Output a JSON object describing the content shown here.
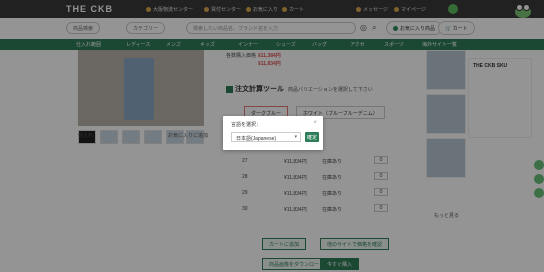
{
  "site": {
    "logo": "THE CKB"
  },
  "topbar": {
    "items": [
      "大阪物流センター",
      "買付センター",
      "お気に入り",
      "カート",
      "メッセージ",
      "マイページ"
    ]
  },
  "search": {
    "scope": "商品検索",
    "category": "カテゴリー",
    "placeholder": "検索したい商品名、ブランド名を入力",
    "fav_button": "お気に入り商品",
    "cart_button": "カート"
  },
  "nav": {
    "items": [
      "仕入れ範囲",
      "レディース",
      "メンズ",
      "キッズ",
      "インナー",
      "シューズ",
      "バッグ",
      "アクセ",
      "スポーツ",
      "海外サイト一覧"
    ]
  },
  "product": {
    "price_label": "各数購入価格",
    "price1": "¥11,384円",
    "price2": "¥11,834円",
    "tool_title": "注文計算ツール",
    "variation_note": "商品バリエーションを選択して下さい",
    "color_tab1": "ダークブルー",
    "color_tab2": "ホワイト（ブルーブルーデニム）",
    "thumb_label1": "仕入れ",
    "thumb_label2": "お気に入りに追加",
    "rows": [
      {
        "size": "27",
        "price": "¥11,834円",
        "stock": "在庫あり",
        "qty": "0"
      },
      {
        "size": "28",
        "price": "¥11,834円",
        "stock": "在庫あり",
        "qty": "0"
      },
      {
        "size": "29",
        "price": "¥11,834円",
        "stock": "在庫あり",
        "qty": "0"
      },
      {
        "size": "30",
        "price": "¥11,834円",
        "stock": "在庫あり",
        "qty": "0"
      }
    ],
    "btn_cart": "カートに追加",
    "btn_other": "他のサイトで価格を確認",
    "btn_download": "商品画像をダウンロード",
    "btn_buy": "今すぐ購入"
  },
  "side": {
    "title": "THE CKB SKU",
    "more": "もっと見る"
  },
  "modal": {
    "title": "言語を選択：",
    "selected": "日本語(Japanese)",
    "confirm": "確定",
    "close": "×"
  },
  "colors": {
    "brand_green": "#2d7d58",
    "topbar": "#3a3a3a"
  }
}
